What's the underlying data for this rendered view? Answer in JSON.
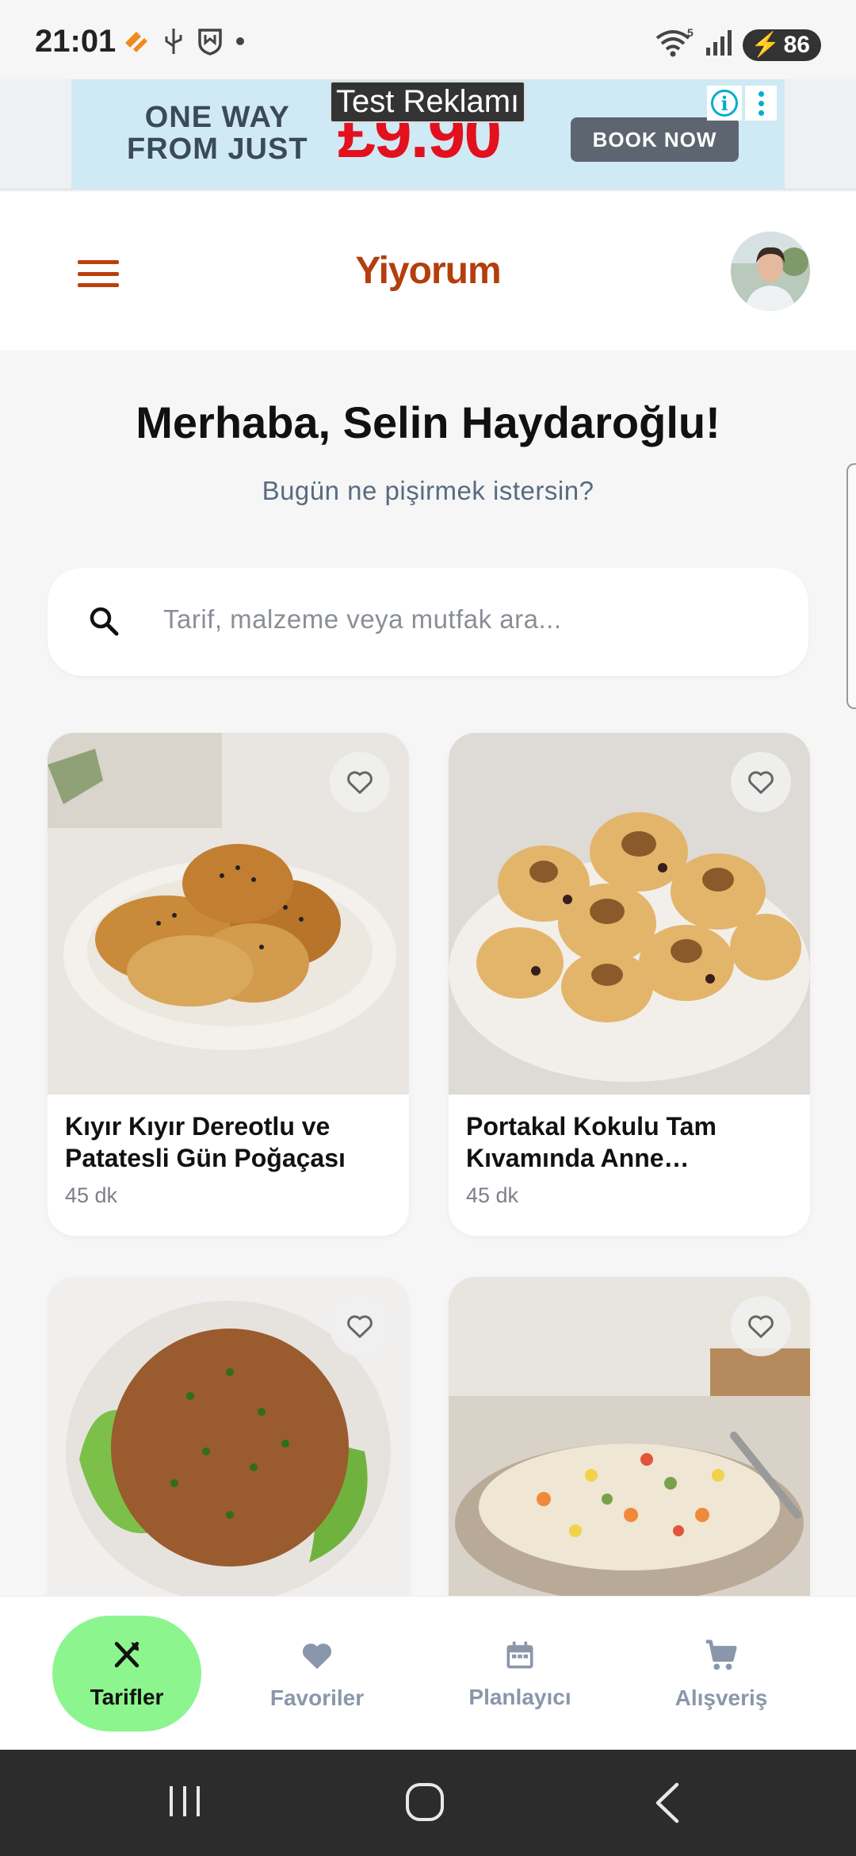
{
  "status_bar": {
    "time": "21:01",
    "battery": "86",
    "network": "5"
  },
  "ad": {
    "label": "Test Reklamı",
    "headline_line1": "ONE WAY",
    "headline_line2": "FROM JUST",
    "price": "£9.90",
    "cta": "BOOK NOW"
  },
  "header": {
    "title": "Yiyorum",
    "menu_icon": "hamburger-menu-icon",
    "avatar_icon": "user-avatar"
  },
  "greeting": {
    "title": "Merhaba, Selin Haydaroğlu!",
    "subtitle": "Bugün ne pişirmek istersin?"
  },
  "search": {
    "placeholder": "Tarif, malzeme veya mutfak ara..."
  },
  "recipes": [
    {
      "title": "Kıyır Kıyır Dereotlu ve Patatesli Gün Poğaçası",
      "time": "45 dk"
    },
    {
      "title": "Portakal Kokulu Tam Kıvamında Anne Kurabiyesi",
      "time": "45 dk"
    },
    {
      "title": "",
      "time": ""
    },
    {
      "title": "",
      "time": ""
    }
  ],
  "nav": {
    "items": [
      {
        "label": "Tarifler",
        "icon": "fork-knife-icon",
        "active": true
      },
      {
        "label": "Favoriler",
        "icon": "heart-icon",
        "active": false
      },
      {
        "label": "Planlayıcı",
        "icon": "calendar-icon",
        "active": false
      },
      {
        "label": "Alışveriş",
        "icon": "cart-icon",
        "active": false
      }
    ]
  },
  "colors": {
    "brand": "#b43e0d",
    "nav_active": "#8cf58e",
    "nav_inactive": "#8a97ab",
    "subtitle": "#5a6b80"
  }
}
